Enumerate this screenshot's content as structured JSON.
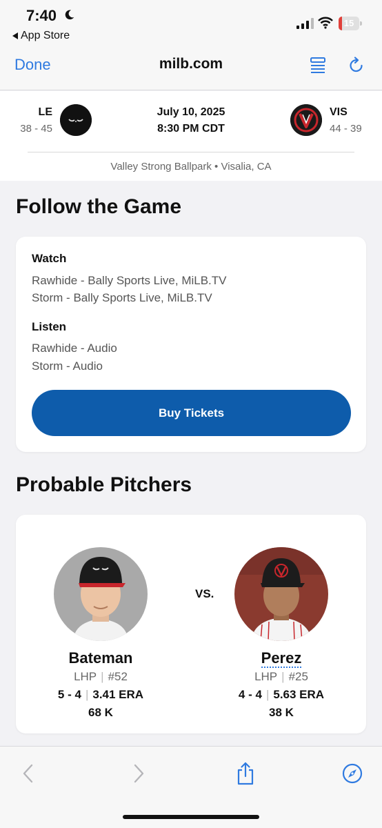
{
  "status_bar": {
    "time": "7:40",
    "back_app": "App Store",
    "battery": "15",
    "battery_level": 0.15
  },
  "browser": {
    "done_label": "Done",
    "url": "milb.com"
  },
  "matchup": {
    "away": {
      "abbr": "LE",
      "record": "38 - 45"
    },
    "home": {
      "abbr": "VIS",
      "record": "44 - 39"
    },
    "date": "July 10, 2025",
    "time": "8:30 PM CDT",
    "venue": "Valley Strong Ballpark • Visalia, CA"
  },
  "follow": {
    "title": "Follow the Game",
    "watch_label": "Watch",
    "watch_items": [
      "Rawhide - Bally Sports Live, MiLB.TV",
      "Storm - Bally Sports Live, MiLB.TV"
    ],
    "listen_label": "Listen",
    "listen_items": [
      "Rawhide - Audio",
      "Storm - Audio"
    ],
    "buy_label": "Buy Tickets"
  },
  "pitchers": {
    "title": "Probable Pitchers",
    "vs": "VS.",
    "away": {
      "name": "Bateman",
      "hand": "LHP",
      "number": "#52",
      "record": "5 - 4",
      "era": "3.41 ERA",
      "k": "68 K"
    },
    "home": {
      "name": "Perez",
      "hand": "LHP",
      "number": "#25",
      "record": "4 - 4",
      "era": "5.63 ERA",
      "k": "38 K"
    }
  },
  "colors": {
    "accent": "#2f7ae0",
    "button": "#0e5cab",
    "battery_low": "#e0403a"
  }
}
